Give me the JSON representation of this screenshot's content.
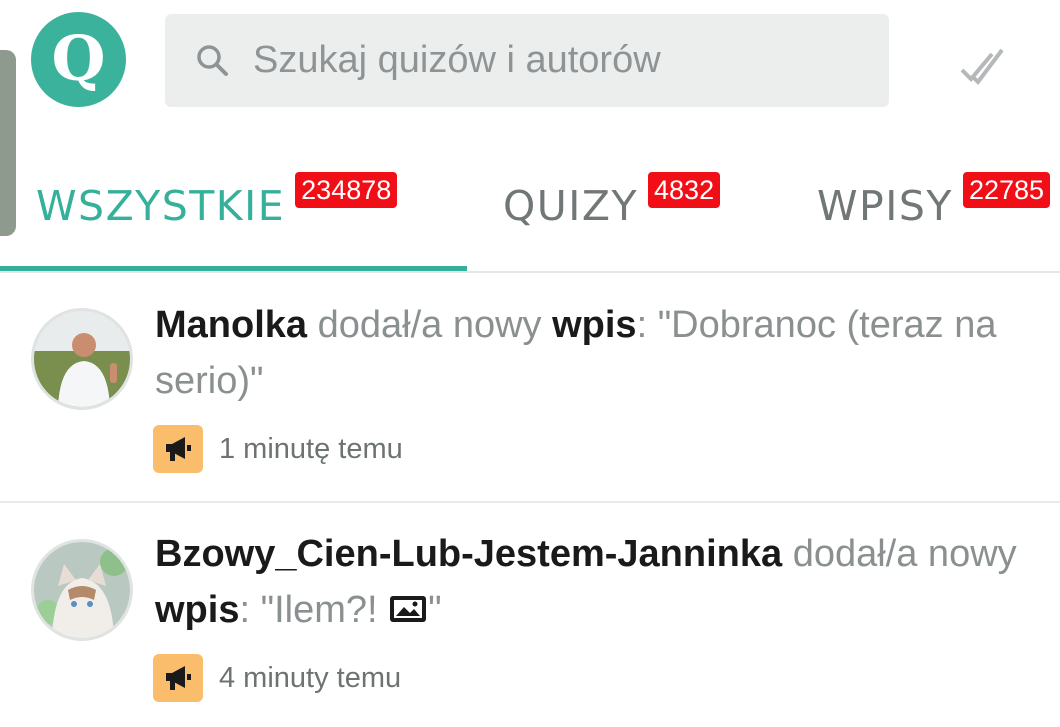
{
  "header": {
    "logo_letter": "Q",
    "search": {
      "placeholder": "Szukaj quizów i autorów",
      "value": ""
    },
    "icons": {
      "search": "search-icon",
      "mark_read": "double-check-icon"
    },
    "colors": {
      "brand": "#3bb39c",
      "accent": "#35b09a",
      "badge": "#f20e16"
    }
  },
  "tabs": [
    {
      "label": "WSZYSTKIE",
      "count": "234878",
      "active": true
    },
    {
      "label": "QUIZY",
      "count": "4832",
      "active": false
    },
    {
      "label": "WPISY",
      "count": "22785",
      "active": false
    }
  ],
  "feed": [
    {
      "user": "Manolka",
      "action": "dodał/a nowy",
      "kind": "wpis",
      "title_open": ": \"Dobranoc (teraz na serio)\"",
      "has_image": false,
      "time": "1 minutę temu",
      "type_icon": "megaphone-icon"
    },
    {
      "user": "Bzowy_Cien-Lub-Jestem-Janninka",
      "action": "dodał/a nowy",
      "kind": "wpis",
      "title_open": ": \"Ilem?! ",
      "title_close": "\"",
      "has_image": true,
      "image_icon": "image-icon",
      "time": "4 minuty temu",
      "type_icon": "megaphone-icon"
    }
  ]
}
